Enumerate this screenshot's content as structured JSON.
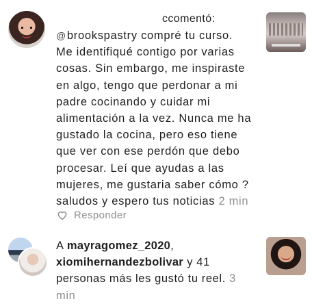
{
  "comment": {
    "header": "ccomentó:",
    "mention": "brookspastry",
    "lines": [
      " compré tu curso.",
      "Me identifiqué contigo por varias",
      "cosas. Sin embargo, me inspiraste",
      "en algo, tengo que perdonar a mi",
      "padre cocinando y cuidar mi",
      "alimentación a la vez. Nunca me ha",
      "gustado la cocina, pero eso tiene",
      "que ver con ese perdón que debo",
      "procesar. Leí que ayudas a las",
      "mujeres, me gustaria saber cómo ?",
      "saludos y espero tus noticias "
    ],
    "time": "2 min",
    "reply_label": "Responder",
    "icons": {
      "mention": "threads-at-icon",
      "like": "heart-outline-icon"
    }
  },
  "likes": {
    "prefix": "A ",
    "user1": "mayragomez_2020",
    "comma": ",",
    "user2": "xiomihernandezbolivar",
    "text_after": " y 41",
    "line3": "personas más les gustó tu reel.",
    "time_part1": " 3",
    "time_part2": "min"
  },
  "colors": {
    "text": "#1e1e1e",
    "muted": "#8e8e8e",
    "background": "#ffffff"
  }
}
